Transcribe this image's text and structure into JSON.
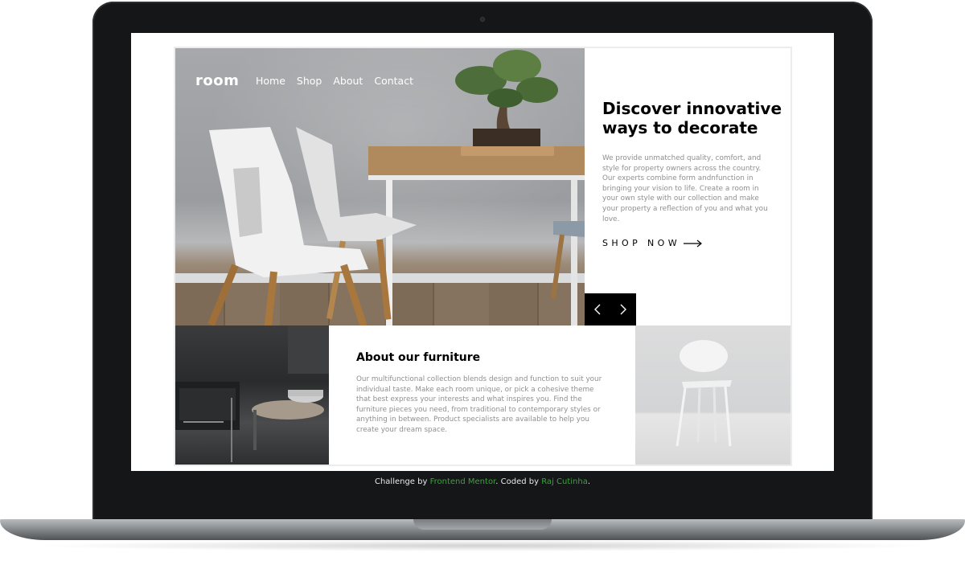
{
  "site": {
    "logo": "room",
    "nav": [
      "Home",
      "Shop",
      "About",
      "Contact"
    ]
  },
  "hero": {
    "headline_line1": "Discover innovative",
    "headline_line2": "ways to decorate",
    "body": "We provide unmatched quality, comfort, and style for property owners across the country. Our experts combine form andnfunction in bringing your vision to life. Create a room in your own style with our collection and make your property a reflection of you and what you love.",
    "cta": "SHOP NOW"
  },
  "about": {
    "title": "About our furniture",
    "body": "Our multifunctional collection blends design and function to suit your individual taste. Make each room unique, or pick a cohesive theme that best express your interests and what inspires you. Find the furniture pieces you need, from traditional to contemporary styles or anything in between. Product specialists are available to help you create your dream space."
  },
  "attribution": {
    "prefix": "Challenge by ",
    "link1": "Frontend Mentor",
    "middle": ". Coded by ",
    "link2": "Raj Cutinha",
    "suffix": "."
  },
  "icons": {
    "prev": "chevron-left-icon",
    "next": "chevron-right-icon",
    "cta_arrow": "arrow-right-icon"
  },
  "colors": {
    "laptop_frame": "#141617",
    "link_green": "#3ea23e",
    "slider_bg": "#000000",
    "muted_text": "#8f8f8f"
  }
}
